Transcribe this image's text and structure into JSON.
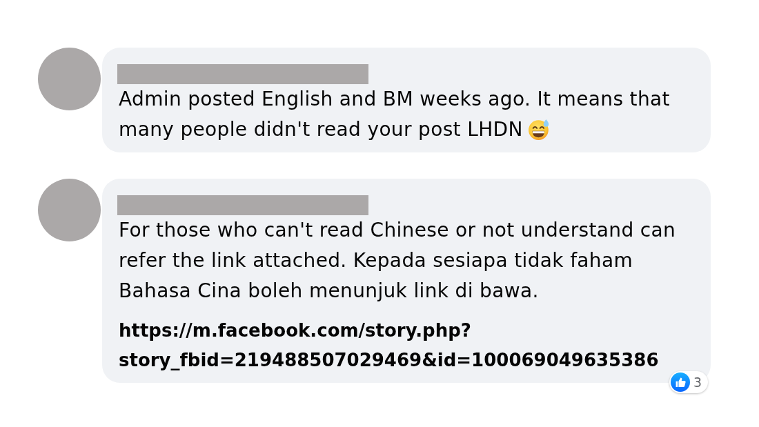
{
  "comments": [
    {
      "author_redacted": true,
      "body": [
        {
          "kind": "text",
          "text": "Admin posted English and BM weeks ago. It means that many people didn't read your post LHDN",
          "trailing_emoji": true
        }
      ]
    },
    {
      "author_redacted": true,
      "body": [
        {
          "kind": "text",
          "text": "For those who can't read Chinese or not understand can refer the link attached. Kepada sesiapa tidak faham Bahasa Cina boleh menunjuk link di bawa.",
          "trailing_emoji": false
        },
        {
          "kind": "link",
          "text": "https://m.facebook.com/story.php?story_fbid=219488507029469&id=100069049635386"
        }
      ],
      "reactions": {
        "count": "3"
      }
    }
  ]
}
